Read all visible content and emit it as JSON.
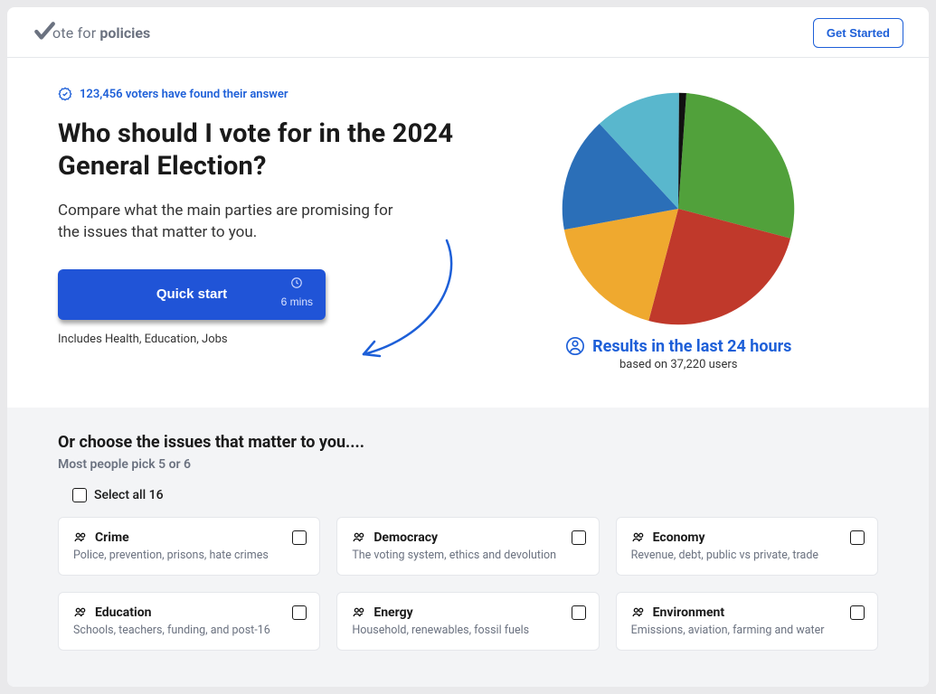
{
  "header": {
    "logo_word1": "ote for",
    "logo_word2": "policies",
    "get_started": "Get Started"
  },
  "hero": {
    "voters_line": "123,456 voters have found their answer",
    "title": "Who should I vote for in the 2024 General Election?",
    "subtitle": "Compare what the main parties are promising for the issues that matter to you.",
    "quick_start_label": "Quick start",
    "quick_start_mins": "6 mins",
    "includes": "Includes Health, Education, Jobs"
  },
  "results": {
    "headline": "Results in the last 24 hours",
    "subline": "based on 37,220 users"
  },
  "issues": {
    "title": "Or choose the issues that matter to you....",
    "hint": "Most people pick 5 or 6",
    "select_all": "Select all 16",
    "cards": [
      {
        "title": "Crime",
        "desc": "Police, prevention, prisons, hate crimes"
      },
      {
        "title": "Democracy",
        "desc": "The voting system, ethics and devolution"
      },
      {
        "title": "Economy",
        "desc": "Revenue, debt, public vs private, trade"
      },
      {
        "title": "Education",
        "desc": "Schools, teachers, funding, and post-16"
      },
      {
        "title": "Energy",
        "desc": "Household, renewables, fossil fuels"
      },
      {
        "title": "Environment",
        "desc": "Emissions, aviation, farming and water"
      }
    ]
  },
  "chart_data": {
    "type": "pie",
    "title": "Results in the last 24 hours",
    "series": [
      {
        "name": "Green",
        "value": 28,
        "color": "#51a13b"
      },
      {
        "name": "Red",
        "value": 25,
        "color": "#c0392b"
      },
      {
        "name": "Amber",
        "value": 18,
        "color": "#efa92f"
      },
      {
        "name": "Blue",
        "value": 16,
        "color": "#2b6fb8"
      },
      {
        "name": "Cyan",
        "value": 12,
        "color": "#59b7cd"
      },
      {
        "name": "Black",
        "value": 1,
        "color": "#111111"
      }
    ]
  }
}
